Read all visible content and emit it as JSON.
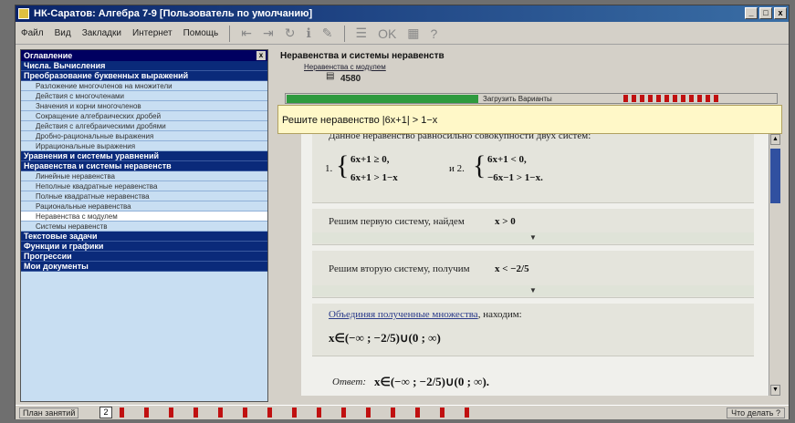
{
  "window": {
    "title": "НК-Саратов: Алгебра 7-9 [Пользователь по умолчанию]",
    "controls": [
      "_",
      "□",
      "x"
    ]
  },
  "menu": [
    "Файл",
    "Вид",
    "Закладки",
    "Интернет",
    "Помощь"
  ],
  "toolbar": {
    "ok_label": "OK"
  },
  "toc": {
    "header": "Оглавление",
    "close": "x",
    "sections_top": [
      "Числа. Вычисления",
      "Преобразование буквенных выражений"
    ],
    "items_1": [
      "Разложение многочленов на множители",
      "Действия с многочленами",
      "Значения и корни многочленов",
      "Сокращение алгебраических дробей",
      "Действия с алгебраическими дробями",
      "Дробно-рациональные выражения",
      "Иррациональные выражения"
    ],
    "sections_mid": [
      "Уравнения и системы уравнений",
      "Неравенства и системы неравенств"
    ],
    "items_2": [
      "Линейные неравенства",
      "Неполные квадратные неравенства",
      "Полные квадратные неравенства",
      "Рациональные неравенства",
      "Неравенства с модулем",
      "Системы неравенств"
    ],
    "sections_bottom": [
      "Текстовые задачи",
      "Функции и графики",
      "Прогрессии",
      "Мои документы"
    ]
  },
  "content": {
    "section_title": "Неравенства и системы неравенств",
    "crumb_link": "Неравенства с модулем",
    "task_number": "4580",
    "taskbar_text": "Загрузить  Варианты",
    "prompt": "Решите неравенство |6x+1| > 1−x",
    "intro": "Данное неравенство равносильно совокупности двух систем:",
    "system1_label": "1.",
    "system1_line1": "6x+1 ≥ 0,",
    "system1_line2": "6x+1 > 1−x",
    "and": "и 2.",
    "system2_line1": "6x+1 < 0,",
    "system2_line2": "−6x−1 > 1−x.",
    "step1": "Решим первую систему, найдем",
    "step1_result": "x > 0",
    "step2": "Решим вторую систему, получим",
    "step2_result": "x < −2/5",
    "step3_link": "Объединяя полученные множества",
    "step3_rest": ", находим:",
    "union": "x∈(−∞ ; −2/5)∪(0 ; ∞)",
    "answer_label": "Ответ:",
    "answer": "x∈(−∞ ; −2/5)∪(0 ; ∞)."
  },
  "status": {
    "left": "План занятий",
    "number": "2",
    "right": "Что делать ?"
  }
}
